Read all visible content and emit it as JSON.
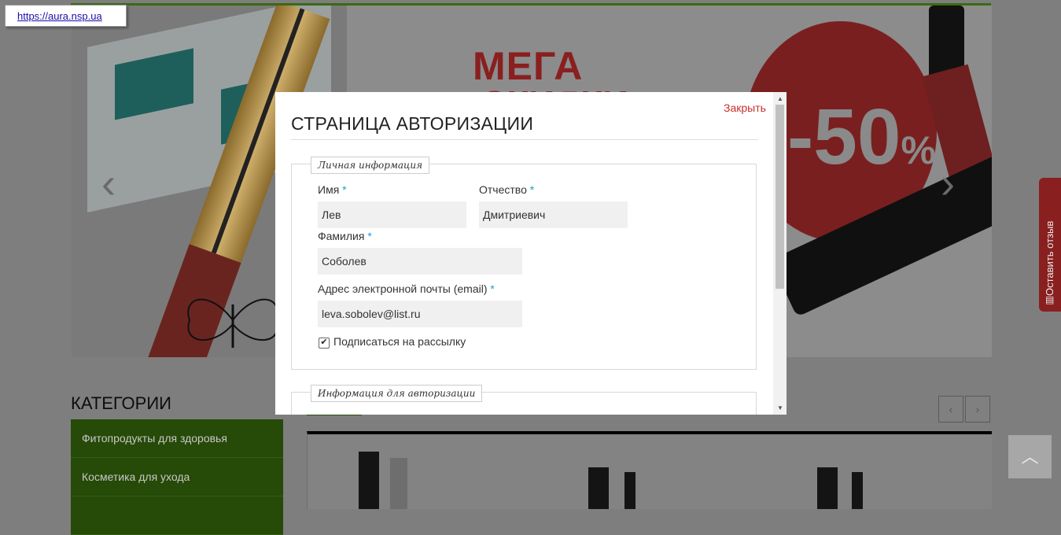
{
  "url_tooltip": "https://aura.nsp.ua",
  "banner": {
    "headline": "МЕГА",
    "headline2": "СКИДКИ",
    "discount": "-50",
    "discount_symbol": "%"
  },
  "categories": {
    "title": "КАТЕГОРИИ",
    "items": [
      {
        "label": "Фитопродукты для здоровья"
      },
      {
        "label": "Косметика для ухода"
      }
    ]
  },
  "feedback_tab": {
    "label": "Оставить отзыв"
  },
  "modal": {
    "close_label": "Закрыть",
    "title": "СТРАНИЦА АВТОРИЗАЦИИ",
    "personal_legend": "Личная информация",
    "auth_legend": "Информация для авторизации",
    "fields": {
      "first_name": {
        "label": "Имя",
        "value": "Лев"
      },
      "patronymic": {
        "label": "Отчество",
        "value": "Дмитриевич"
      },
      "last_name": {
        "label": "Фамилия",
        "value": "Соболев"
      },
      "email": {
        "label": "Адрес электронной почты (email)",
        "value": "leva.sobolev@list.ru"
      }
    },
    "required_mark": "*",
    "subscribe": {
      "label": "Подписаться на рассылку",
      "checked": true
    }
  },
  "colors": {
    "accent_red": "#c9302c",
    "category_green": "#264a07",
    "required_blue": "#1e9bd7"
  }
}
